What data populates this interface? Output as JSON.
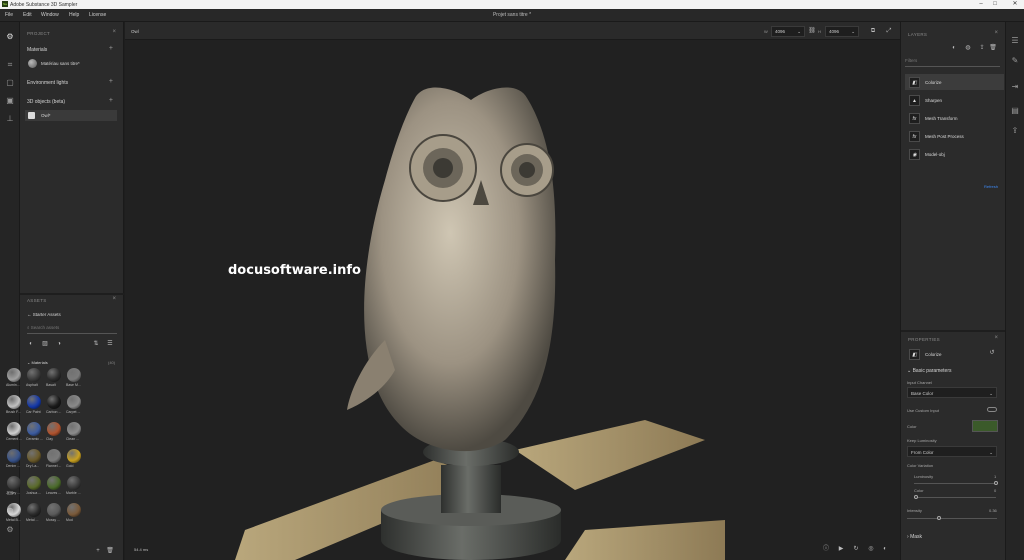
{
  "window": {
    "app_title": "Adobe Substance 3D Sampler",
    "app_icon": "Sa",
    "doc_title": "Projet sans titre *"
  },
  "menu": [
    "File",
    "Edit",
    "Window",
    "Help",
    "License"
  ],
  "project_panel": {
    "header": "PROJECT",
    "materials_label": "Materials",
    "material_item": "Matériau sans titre*",
    "env_lights_label": "Environment lights",
    "objects_label": "3D objects (beta)",
    "object_item": "Owl*"
  },
  "assets_panel": {
    "header": "ASSETS",
    "back_label": "Starter Assets",
    "search_placeholder": "Search assets",
    "group_label": "Materials",
    "group_count": "(40)",
    "materials": [
      {
        "name": "Alumin...",
        "color": "#a0a0a0"
      },
      {
        "name": "Asphalt",
        "color": "#3a3a3a"
      },
      {
        "name": "Basalt",
        "color": "#2c2c2c"
      },
      {
        "name": "Base M...",
        "color": "#7a7a7a"
      },
      {
        "name": "Brush F...",
        "color": "#c0c0c0"
      },
      {
        "name": "Car Paint",
        "color": "#1438a8"
      },
      {
        "name": "Carbon ...",
        "color": "#1a1a1a"
      },
      {
        "name": "Carpet ...",
        "color": "#8a8a8a"
      },
      {
        "name": "Cement ...",
        "color": "#cfcfcf"
      },
      {
        "name": "Ceramic ...",
        "color": "#3c5ca0"
      },
      {
        "name": "Clay",
        "color": "#b0532e"
      },
      {
        "name": "Clean ...",
        "color": "#8c8c8c"
      },
      {
        "name": "Denim ...",
        "color": "#38538a"
      },
      {
        "name": "Dry La...",
        "color": "#6a5a2a"
      },
      {
        "name": "Flannel ...",
        "color": "#7a7a7a"
      },
      {
        "name": "Gold",
        "color": "#c8a020"
      },
      {
        "name": "Jersey ...",
        "color": "#3c3c3c"
      },
      {
        "name": "Joshua ...",
        "color": "#5a6a2a"
      },
      {
        "name": "Leaves ...",
        "color": "#4a6a2a"
      },
      {
        "name": "Marble ...",
        "color": "#3a3a3a"
      },
      {
        "name": "Metal B...",
        "color": "#d8d8d8"
      },
      {
        "name": "Metal ...",
        "color": "#2a2a2a"
      },
      {
        "name": "Mossy ...",
        "color": "#5a5a5a"
      },
      {
        "name": "Mud",
        "color": "#7a5a3a"
      }
    ]
  },
  "viewport": {
    "object_name": "Owl",
    "width_label": "W",
    "width_value": "4096",
    "height_label": "H",
    "height_value": "4096",
    "frame_time": "54.4 ms",
    "watermark": "docusoftware.info"
  },
  "layers_panel": {
    "header": "LAYERS",
    "search_placeholder": "Filters",
    "layers": [
      {
        "name": "Colorize",
        "icon": "colorize-icon",
        "glyph": "◧"
      },
      {
        "name": "Sharpen",
        "icon": "sharpen-icon",
        "glyph": "▲"
      },
      {
        "name": "Mesh Transform",
        "icon": "fx-icon",
        "glyph": "fx"
      },
      {
        "name": "Mesh Post Process",
        "icon": "fx-icon",
        "glyph": "fx"
      },
      {
        "name": "Model-obj",
        "icon": "model-icon",
        "glyph": "◉"
      }
    ],
    "refresh_label": "Refresh"
  },
  "properties_panel": {
    "header": "PROPERTIES",
    "layer_name": "Colorize",
    "section": "Basic parameters",
    "input_channel_label": "Input Channel",
    "input_channel_value": "Base Color",
    "custom_input_label": "Use Custom Input",
    "color_label": "Color",
    "color_value": "#3b5a2a",
    "keep_luminosity_label": "Keep Luminosity",
    "keep_luminosity_value": "From Color",
    "color_variation_label": "Color Variation",
    "luminosity_label": "Luminosity",
    "luminosity_value": "1",
    "color_sub_label": "Color",
    "color_sub_value": "0",
    "intensity_label": "Intensity",
    "intensity_value": "0.36",
    "mask_label": "Mask"
  }
}
